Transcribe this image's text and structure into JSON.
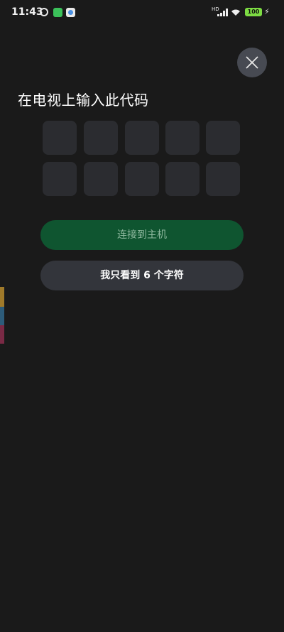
{
  "status_bar": {
    "time": "11:43",
    "hd_label": "HD",
    "battery": "100",
    "icons": [
      "alarm-icon",
      "app-notification-icon",
      "app-notification-icon",
      "signal-icon",
      "wifi-icon",
      "battery-icon",
      "charging-icon"
    ]
  },
  "close": {
    "icon": "close-icon"
  },
  "title": "在电视上输入此代码",
  "code_cells": [
    "",
    "",
    "",
    "",
    "",
    "",
    "",
    "",
    "",
    ""
  ],
  "buttons": {
    "connect": "连接到主机",
    "six_chars": "我只看到 6 个字符"
  },
  "colors": {
    "background": "#1a1a1a",
    "cell": "#2b2c30",
    "connect_button": "#0f5530",
    "secondary_button": "#33353b",
    "close_button": "#474a52"
  }
}
